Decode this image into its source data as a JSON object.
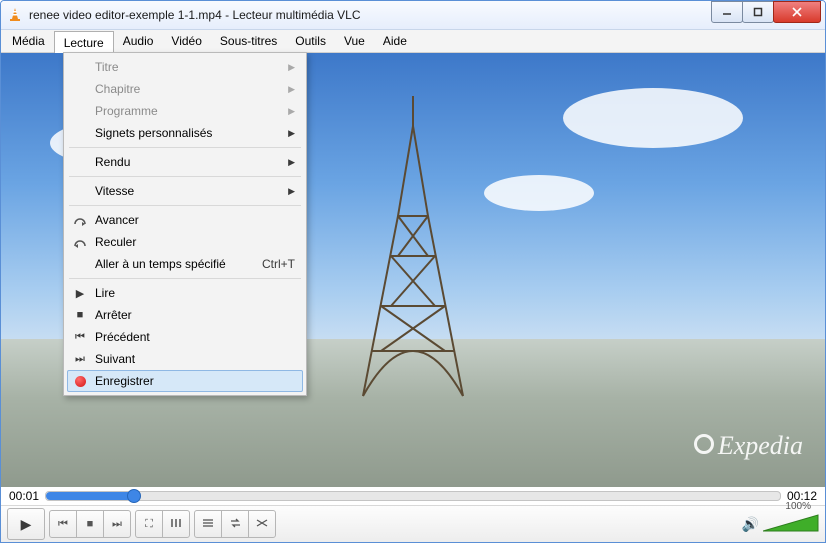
{
  "window": {
    "title": "renee video editor-exemple 1-1.mp4 - Lecteur multimédia VLC"
  },
  "menubar": [
    "Média",
    "Lecture",
    "Audio",
    "Vidéo",
    "Sous-titres",
    "Outils",
    "Vue",
    "Aide"
  ],
  "open_menu_index": 1,
  "dropdown": {
    "items": [
      {
        "label": "Titre",
        "disabled": true,
        "submenu": true
      },
      {
        "label": "Chapitre",
        "disabled": true,
        "submenu": true
      },
      {
        "label": "Programme",
        "disabled": true,
        "submenu": true
      },
      {
        "label": "Signets personnalisés",
        "submenu": true
      },
      {
        "sep": true
      },
      {
        "label": "Rendu",
        "submenu": true
      },
      {
        "sep": true
      },
      {
        "label": "Vitesse",
        "submenu": true
      },
      {
        "sep": true
      },
      {
        "label": "Avancer",
        "icon": "jump-fwd"
      },
      {
        "label": "Reculer",
        "icon": "jump-bwd"
      },
      {
        "label": "Aller à un temps spécifié",
        "hotkey": "Ctrl+T"
      },
      {
        "sep": true
      },
      {
        "label": "Lire",
        "icon": "play"
      },
      {
        "label": "Arrêter",
        "icon": "stop"
      },
      {
        "label": "Précédent",
        "icon": "prev"
      },
      {
        "label": "Suivant",
        "icon": "next"
      },
      {
        "label": "Enregistrer",
        "icon": "record",
        "hover": true
      }
    ]
  },
  "watermark": "Expedia",
  "time": {
    "current": "00:01",
    "total": "00:12",
    "progress_pct": 12
  },
  "volume": {
    "label": "100%"
  }
}
